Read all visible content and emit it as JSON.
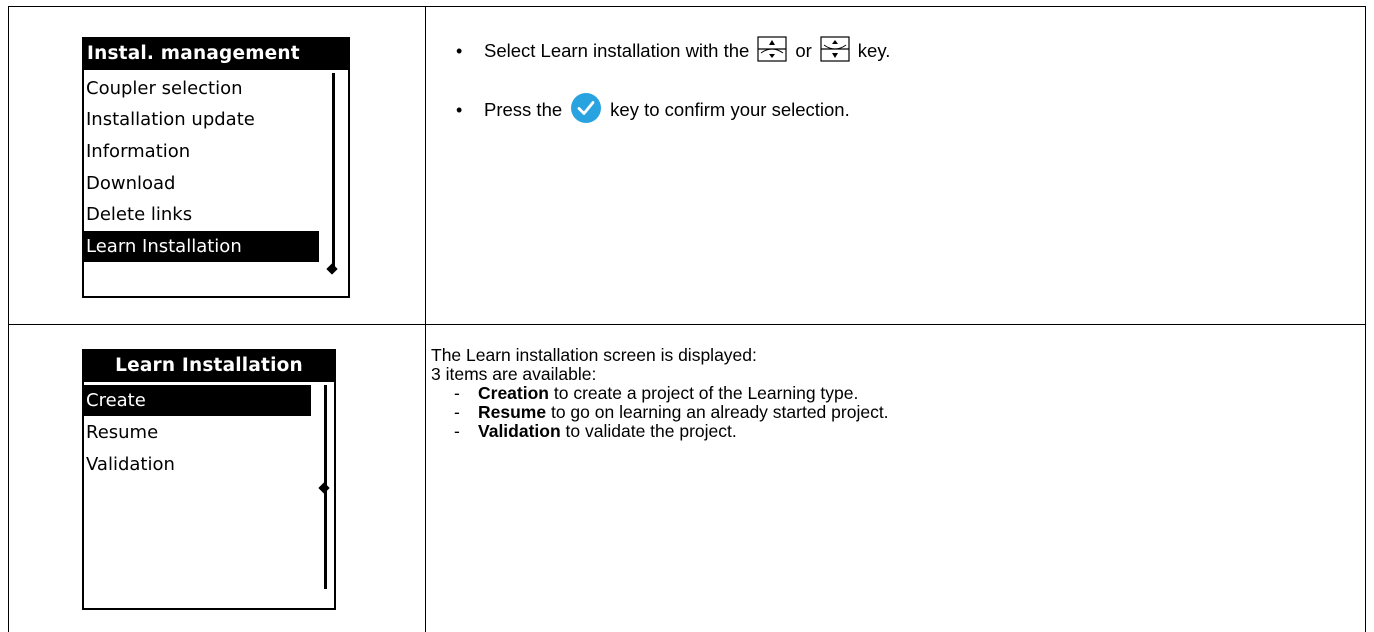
{
  "screen1": {
    "title": "Instal. management",
    "items": [
      "Coupler selection",
      "Installation update",
      "Information",
      "Download",
      "Delete links",
      "Learn Installation"
    ],
    "selected_index": 5
  },
  "screen2": {
    "title": "Learn Installation",
    "items": [
      "Create",
      "Resume",
      "Validation"
    ],
    "selected_index": 0
  },
  "instructions": {
    "line1_pre": "Select Learn installation with the",
    "line1_mid": "or",
    "line1_post": "key.",
    "line2_pre": "Press the",
    "line2_post": "key to confirm your selection."
  },
  "description": {
    "intro": "The Learn installation screen is displayed:",
    "count": "3 items are available:",
    "items": [
      {
        "term": "Creation",
        "text": "to create a project of the Learning type."
      },
      {
        "term": "Resume",
        "text": "to go on learning an already started project."
      },
      {
        "term": "Validation",
        "text": "to validate the project."
      }
    ]
  },
  "icons": {
    "up_key": "up-key-icon",
    "down_key": "down-key-icon",
    "confirm_key": "check-circle-icon"
  },
  "colors": {
    "confirm_accent": "#29a3e0"
  }
}
